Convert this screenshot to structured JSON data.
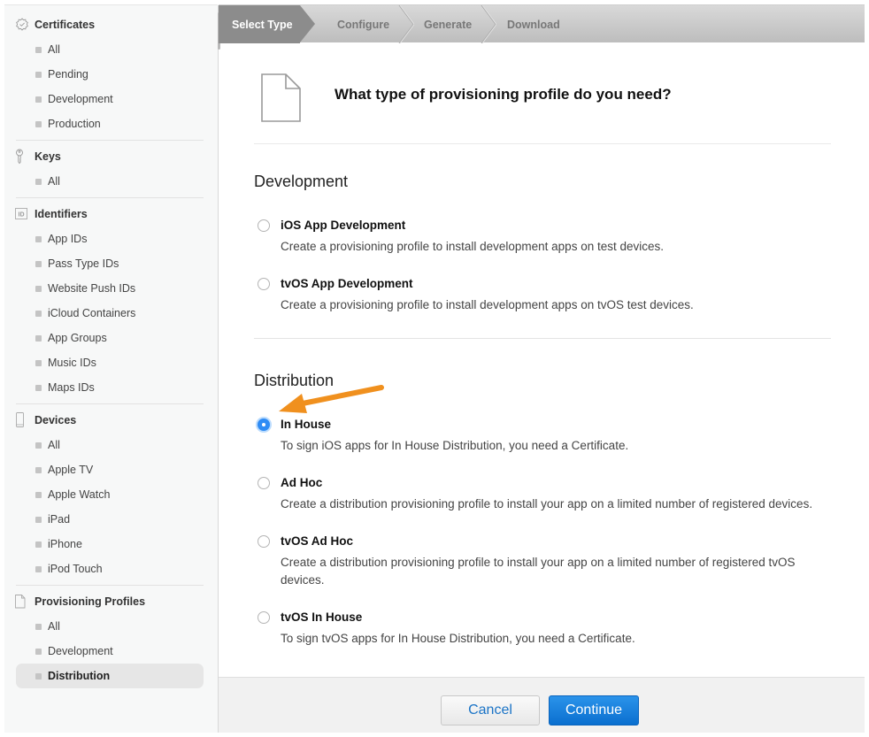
{
  "sidebar": {
    "sections": [
      {
        "icon": "certificate-badge-icon",
        "label": "Certificates",
        "items": [
          "All",
          "Pending",
          "Development",
          "Production"
        ]
      },
      {
        "icon": "key-icon",
        "label": "Keys",
        "items": [
          "All"
        ]
      },
      {
        "icon": "id-icon",
        "label": "Identifiers",
        "items": [
          "App IDs",
          "Pass Type IDs",
          "Website Push IDs",
          "iCloud Containers",
          "App Groups",
          "Music IDs",
          "Maps IDs"
        ]
      },
      {
        "icon": "device-icon",
        "label": "Devices",
        "items": [
          "All",
          "Apple TV",
          "Apple Watch",
          "iPad",
          "iPhone",
          "iPod Touch"
        ]
      },
      {
        "icon": "document-icon",
        "label": "Provisioning Profiles",
        "items": [
          "All",
          "Development",
          "Distribution"
        ]
      }
    ],
    "active": "Provisioning Profiles / Distribution"
  },
  "steps": [
    "Select Type",
    "Configure",
    "Generate",
    "Download"
  ],
  "active_step": "Select Type",
  "header": {
    "title": "What type of provisioning profile do you need?"
  },
  "development": {
    "title": "Development",
    "options": [
      {
        "title": "iOS App Development",
        "desc": "Create a provisioning profile to install development apps on test devices.",
        "checked": false
      },
      {
        "title": "tvOS App Development",
        "desc": "Create a provisioning profile to install development apps on tvOS test devices.",
        "checked": false
      }
    ]
  },
  "distribution": {
    "title": "Distribution",
    "options": [
      {
        "title": "In House",
        "desc": "To sign iOS apps for In House Distribution, you need a Certificate.",
        "checked": true
      },
      {
        "title": "Ad Hoc",
        "desc": "Create a distribution provisioning profile to install your app on a limited number of registered devices.",
        "checked": false
      },
      {
        "title": "tvOS Ad Hoc",
        "desc": "Create a distribution provisioning profile to install your app on a limited number of registered tvOS devices.",
        "checked": false
      },
      {
        "title": "tvOS In House",
        "desc": "To sign tvOS apps for In House Distribution, you need a Certificate.",
        "checked": false
      }
    ]
  },
  "footer": {
    "cancel_label": "Cancel",
    "continue_label": "Continue"
  },
  "colors": {
    "accent": "#0a6fcf",
    "annotation_arrow": "#f0901e",
    "radio_checked": "#2f8cf5"
  }
}
